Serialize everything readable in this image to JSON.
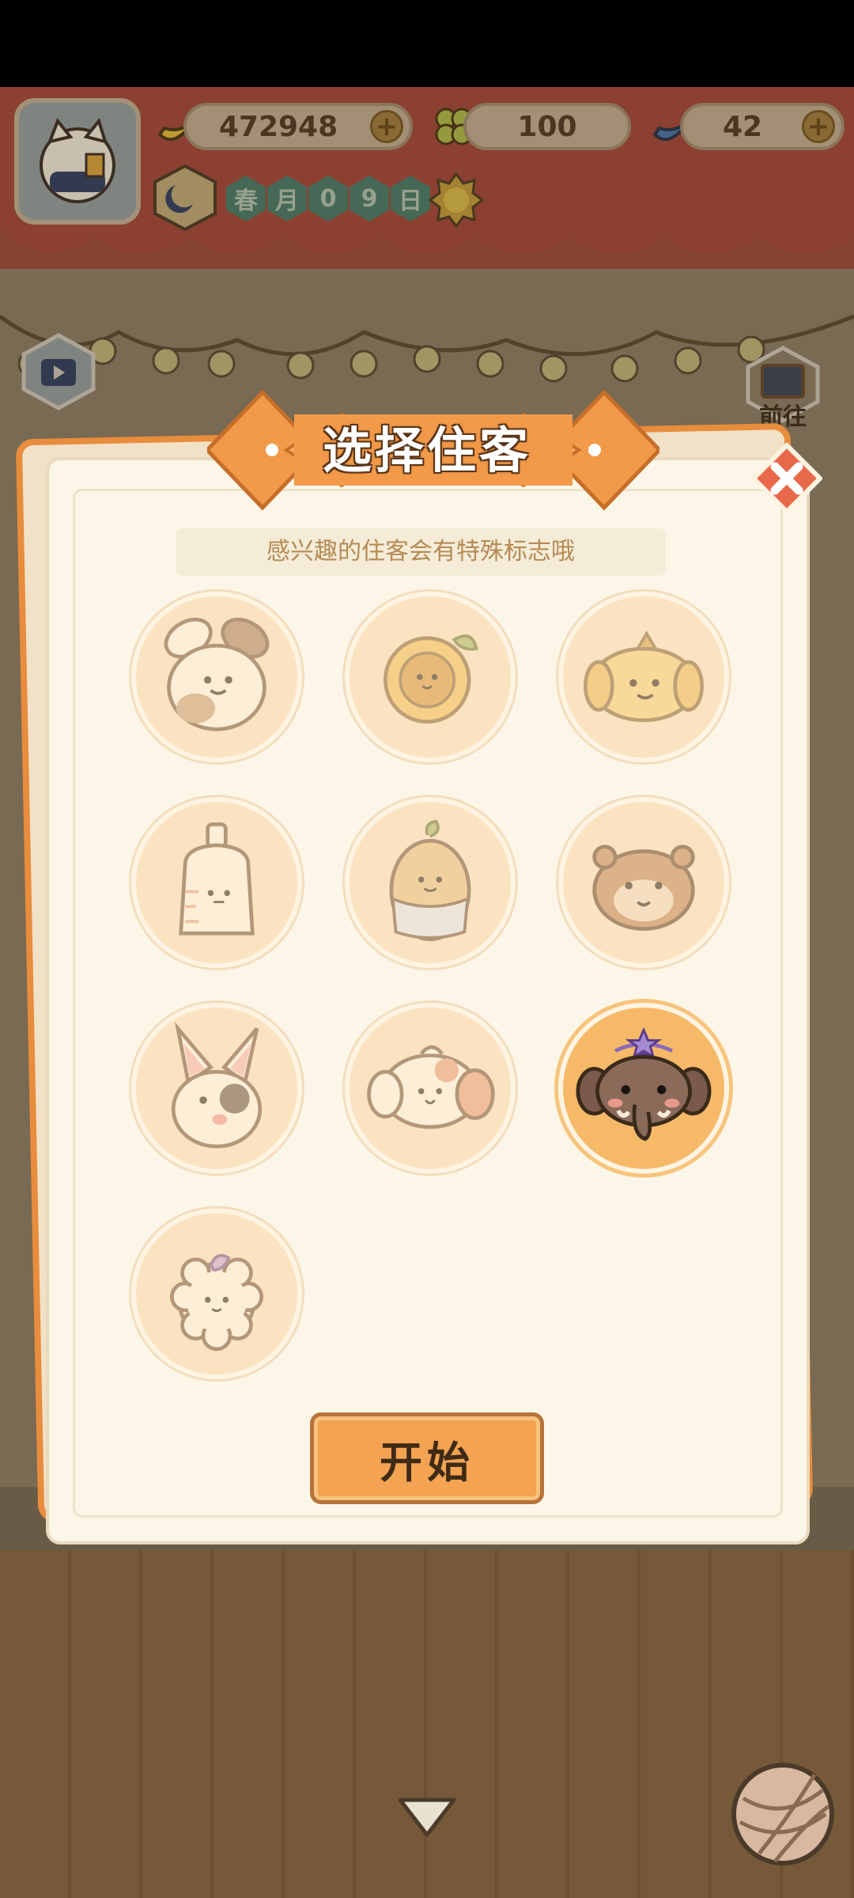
{
  "hud": {
    "bananas": "472948",
    "clovers": "100",
    "blue_bananas": "42",
    "date_chars": [
      "春",
      "月",
      "0",
      "9",
      "日"
    ]
  },
  "side": {
    "goto_label": "前往"
  },
  "dialog": {
    "title": "选择住客",
    "hint": "感兴趣的住客会有特殊标志哦",
    "start_label": "开始",
    "guests": [
      {
        "name": "spotted-bunny",
        "selected": false
      },
      {
        "name": "sunflower",
        "selected": false
      },
      {
        "name": "yellow-puppy",
        "selected": false
      },
      {
        "name": "milk-bottle",
        "selected": false
      },
      {
        "name": "potato-sprout",
        "selected": false
      },
      {
        "name": "hamster",
        "selected": false
      },
      {
        "name": "eyepatch-bunny",
        "selected": false
      },
      {
        "name": "spotted-elephant",
        "selected": false
      },
      {
        "name": "brown-elephant",
        "selected": true
      },
      {
        "name": "fluffy-sheep",
        "selected": false
      }
    ]
  },
  "colors": {
    "accent": "#f3a352",
    "dialog_bg": "#fcf6e8",
    "selected_bg": "#f6b968"
  }
}
